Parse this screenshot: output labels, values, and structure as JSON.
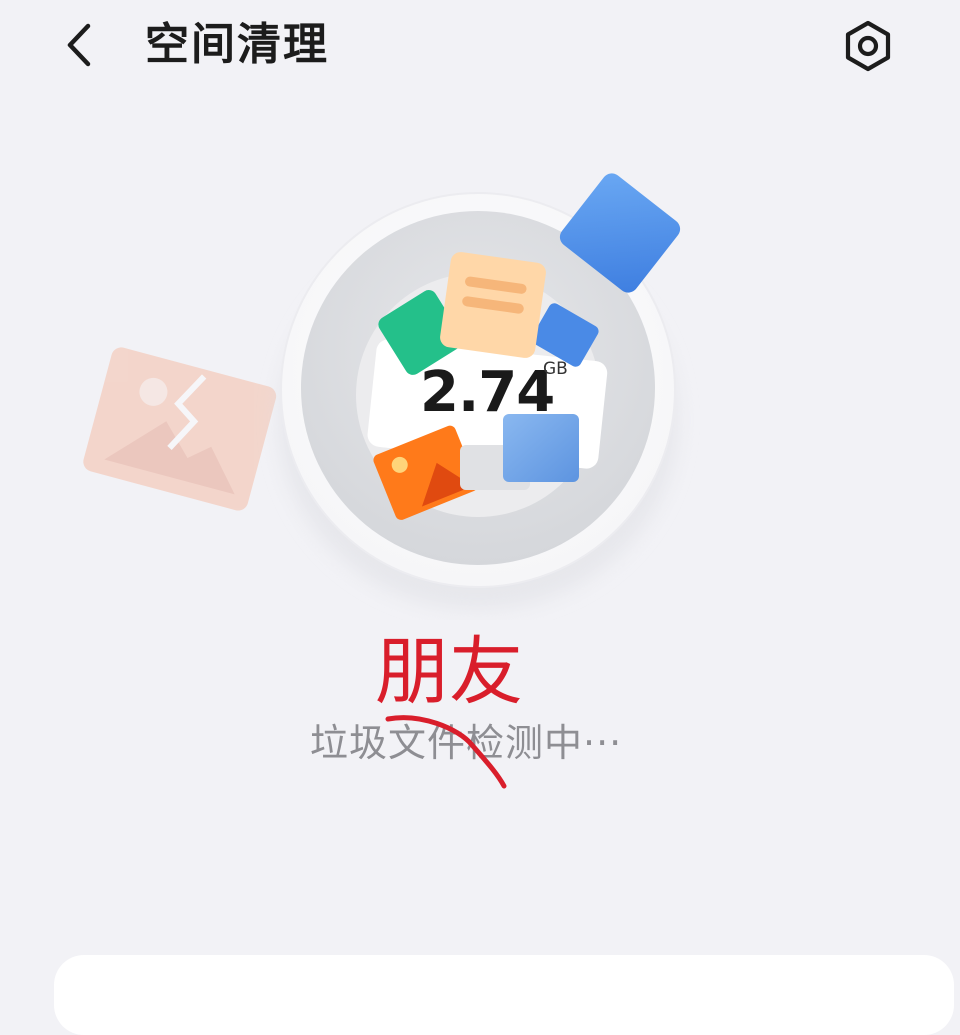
{
  "header": {
    "title": "空间清理",
    "back_icon": "chevron-left-icon",
    "settings_icon": "hexagon-gear-icon"
  },
  "scan": {
    "size_value": "2.74",
    "size_unit": "GB",
    "status": "垃圾文件检测中···"
  },
  "annotation": {
    "text": "朋友",
    "color": "#d91e2b"
  },
  "colors": {
    "background": "#f2f2f6",
    "card": "#ffffff",
    "status_text": "#8e8e93"
  }
}
